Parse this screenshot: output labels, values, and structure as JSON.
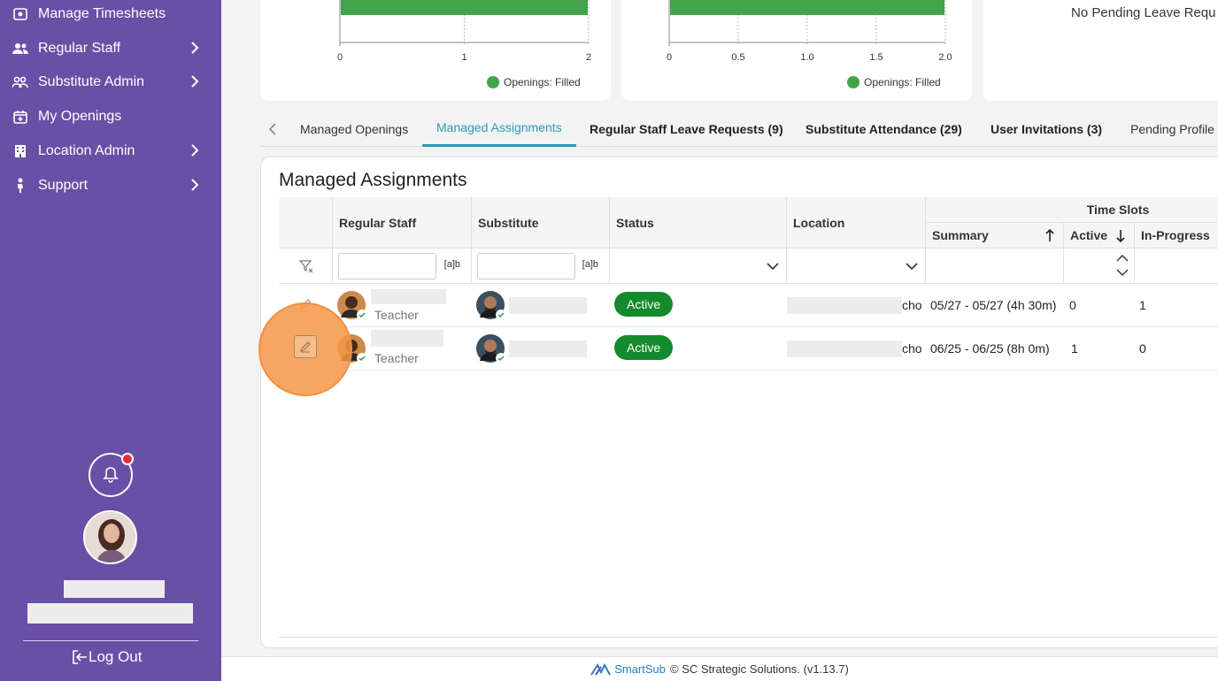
{
  "sidebar": {
    "items": [
      {
        "label": "Manage Timesheets",
        "icon": "timesheet-icon",
        "has_children": false
      },
      {
        "label": "Regular Staff",
        "icon": "people-icon",
        "has_children": true
      },
      {
        "label": "Substitute Admin",
        "icon": "group-icon",
        "has_children": true
      },
      {
        "label": "My Openings",
        "icon": "calendar-plus-icon",
        "has_children": false
      },
      {
        "label": "Location Admin",
        "icon": "building-icon",
        "has_children": true
      },
      {
        "label": "Support",
        "icon": "support-icon",
        "has_children": true
      }
    ],
    "logout_label": "Log Out",
    "accent": "#6a4fa6",
    "notification_dot_color": "#e0303c"
  },
  "charts": {
    "chart1": {
      "ticks": [
        "0",
        "1",
        "2"
      ],
      "legend": "Openings: Filled"
    },
    "chart2": {
      "ticks": [
        "0",
        "0.5",
        "1.0",
        "1.5",
        "2.0"
      ],
      "legend": "Openings: Filled"
    },
    "no_pending": "No Pending Leave Requ"
  },
  "chart_data": [
    {
      "type": "bar",
      "orientation": "horizontal",
      "series": [
        {
          "name": "Openings: Filled",
          "values": [
            2
          ]
        }
      ],
      "xlim": [
        0,
        2
      ],
      "x_ticks": [
        0,
        1,
        2
      ],
      "color": "#43a34a"
    },
    {
      "type": "bar",
      "orientation": "horizontal",
      "series": [
        {
          "name": "Openings: Filled",
          "values": [
            2
          ]
        }
      ],
      "xlim": [
        0,
        2
      ],
      "x_ticks": [
        0,
        0.5,
        1.0,
        1.5,
        2.0
      ],
      "color": "#43a34a"
    }
  ],
  "tabs": [
    {
      "label": "Managed Openings",
      "bold": false,
      "active": false
    },
    {
      "label": "Managed Assignments",
      "bold": false,
      "active": true
    },
    {
      "label": "Regular Staff Leave Requests (9)",
      "bold": true,
      "active": false
    },
    {
      "label": "Substitute Attendance (29)",
      "bold": true,
      "active": false
    },
    {
      "label": "User Invitations (3)",
      "bold": true,
      "active": false
    },
    {
      "label": "Pending Profile I",
      "bold": false,
      "active": false
    }
  ],
  "panel": {
    "title": "Managed Assignments",
    "columns": {
      "regular_staff": "Regular Staff",
      "substitute": "Substitute",
      "status": "Status",
      "location": "Location",
      "time_slots": "Time Slots",
      "summary": "Summary",
      "active": "Active",
      "in_progress": "In-Progress"
    },
    "filter_toggle": "[a]b",
    "rows": [
      {
        "role": "Teacher",
        "status": "Active",
        "location_tail": "cho",
        "summary": "05/27 - 05/27 (4h 30m)",
        "active": "0",
        "in_progress": "1"
      },
      {
        "role": "Teacher",
        "status": "Active",
        "location_tail": "cho",
        "summary": "06/25 - 06/25 (8h 0m)",
        "active": "1",
        "in_progress": "0"
      }
    ],
    "status_color": "#138a2b"
  },
  "footer": {
    "brand": "SmartSub",
    "text": "© SC Strategic Solutions. (v1.13.7)"
  }
}
